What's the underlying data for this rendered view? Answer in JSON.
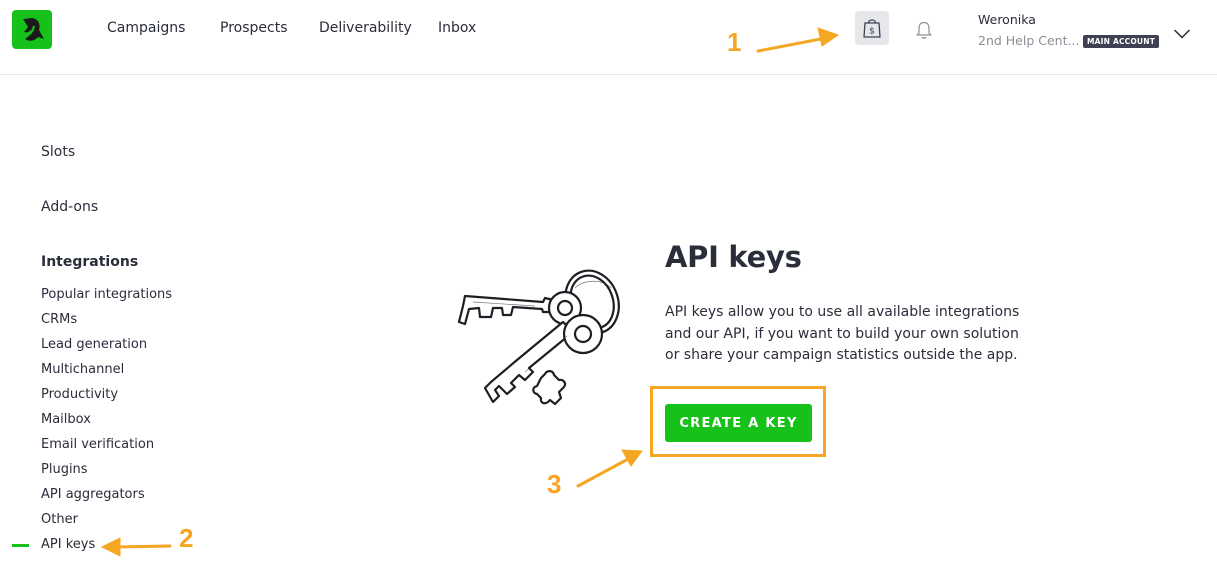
{
  "nav": {
    "items": [
      {
        "label": "Campaigns"
      },
      {
        "label": "Prospects"
      },
      {
        "label": "Deliverability"
      },
      {
        "label": "Inbox"
      }
    ]
  },
  "header": {
    "shop_icon": "shopping-bag-dollar-icon",
    "bell_icon": "notification-bell-icon",
    "user": {
      "name": "Weronika",
      "company": "2nd Help Cent...",
      "badge": "MAIN ACCOUNT"
    }
  },
  "sidebar": {
    "top_items": [
      {
        "label": "Slots"
      },
      {
        "label": "Add-ons"
      }
    ],
    "section_heading": "Integrations",
    "sub_items": [
      {
        "label": "Popular integrations"
      },
      {
        "label": "CRMs"
      },
      {
        "label": "Lead generation"
      },
      {
        "label": "Multichannel"
      },
      {
        "label": "Productivity"
      },
      {
        "label": "Mailbox"
      },
      {
        "label": "Email verification"
      },
      {
        "label": "Plugins"
      },
      {
        "label": "API aggregators"
      },
      {
        "label": "Other"
      },
      {
        "label": "API keys"
      }
    ],
    "active_item": "API keys"
  },
  "main": {
    "title": "API keys",
    "description_lines": [
      "API keys allow you to use all available integrations",
      "and our API, if you want to build your own solution",
      "or share your campaign statistics outside the app."
    ],
    "create_button": "CREATE A KEY",
    "illustration": "keys-on-ring-illustration"
  },
  "annotations": {
    "color": "#f5a623",
    "labels": [
      "1",
      "2",
      "3"
    ]
  },
  "colors": {
    "brand_green": "#16c21a",
    "annotation_orange": "#f5a623",
    "badge_dark": "#3e4154"
  }
}
